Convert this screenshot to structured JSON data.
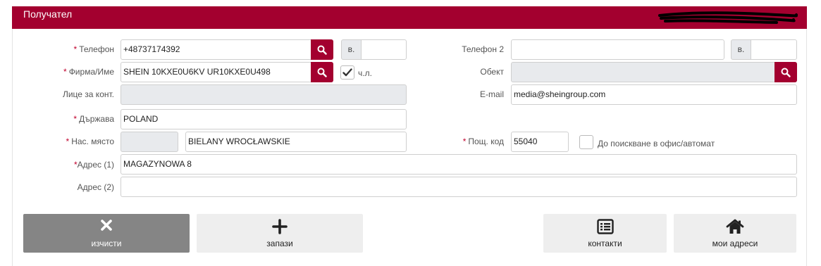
{
  "header": {
    "title": "Получател"
  },
  "fields": {
    "phone": {
      "label": "Телефон",
      "value": "+48737174392",
      "ext_label": "в.",
      "ext_value": ""
    },
    "phone2": {
      "label": "Телефон 2",
      "value": "",
      "ext_label": "в.",
      "ext_value": ""
    },
    "company": {
      "label": "Фирма/Име",
      "value": "SHEIN 10KXE0U6KV UR10KXE0U498",
      "checkbox_label": "ч.л.",
      "checkbox_checked": true
    },
    "object": {
      "label": "Обект",
      "value": ""
    },
    "contact_person": {
      "label": "Лице за конт.",
      "value": ""
    },
    "email": {
      "label": "E-mail",
      "value": "media@sheingroup.com"
    },
    "country": {
      "label": "Държава",
      "value": "POLAND"
    },
    "city": {
      "label": "Нас. място",
      "code_value": "",
      "value": "BIELANY WROCŁAWSKIE"
    },
    "postcode": {
      "label": "Пощ. код",
      "value": "55040",
      "office_label": "До поискване в офис/автомат",
      "office_checked": false
    },
    "address1": {
      "label": "Адрес (1)",
      "value": "MAGAZYNOWA 8"
    },
    "address2": {
      "label": "Адрес (2)",
      "value": ""
    }
  },
  "buttons": {
    "clear": {
      "label": "изчисти",
      "icon": "close-icon"
    },
    "save": {
      "label": "запази",
      "icon": "plus-icon"
    },
    "contacts": {
      "label": "контакти",
      "icon": "list-icon"
    },
    "my_addresses": {
      "label": "мои адреси",
      "icon": "home-icon"
    }
  },
  "colors": {
    "accent": "#a3002f",
    "required": "#c0002c",
    "disabled_bg": "#e8eaed",
    "clear_button": "#858585"
  }
}
